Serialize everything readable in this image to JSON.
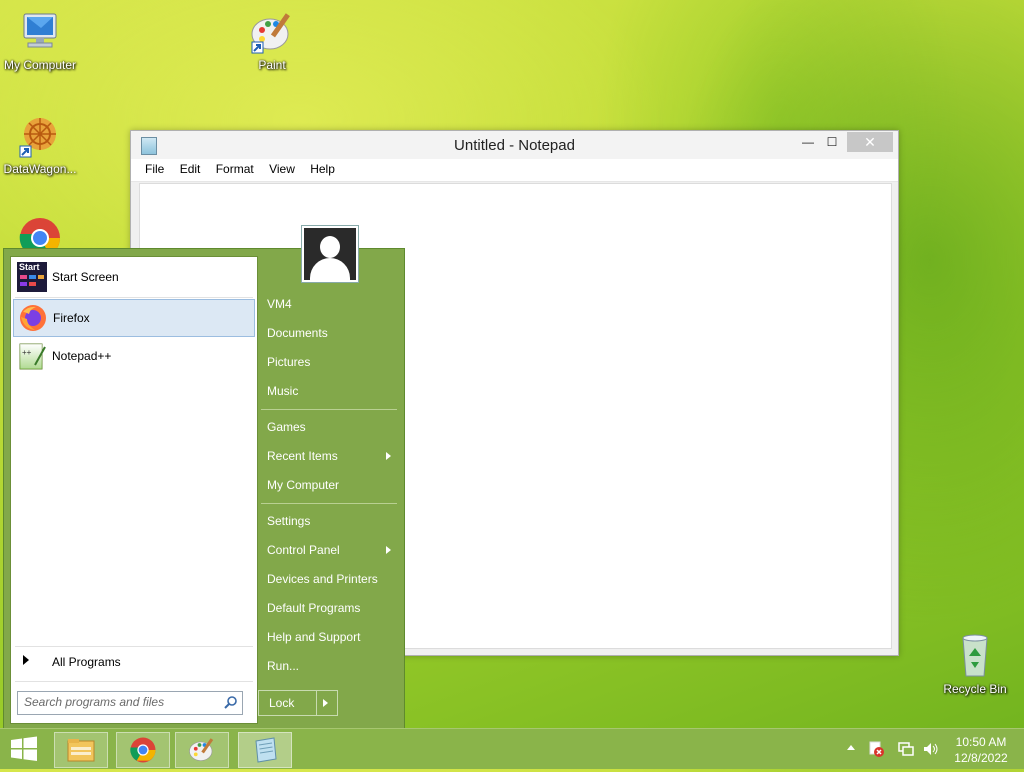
{
  "desktop": {
    "icons": [
      {
        "label": "My Computer",
        "icon": "computer-icon"
      },
      {
        "label": "Paint",
        "icon": "paint-icon"
      },
      {
        "label": "DataWagon...",
        "icon": "datawagon-icon"
      },
      {
        "label": "Recycle Bin",
        "icon": "recycle-bin-icon"
      }
    ]
  },
  "notepad": {
    "title": "Untitled - Notepad",
    "menu": [
      "File",
      "Edit",
      "Format",
      "View",
      "Help"
    ],
    "buttons": {
      "minimize": "—",
      "maximize": "☐",
      "close": "✕"
    },
    "content": ""
  },
  "start_menu": {
    "pinned": [
      {
        "label": "Start Screen",
        "icon": "start-screen-icon"
      },
      {
        "label": "Firefox",
        "icon": "firefox-icon",
        "selected": true
      },
      {
        "label": "Notepad++",
        "icon": "notepadpp-icon"
      }
    ],
    "all_programs": "All Programs",
    "search_placeholder": "Search programs and files",
    "right_items": [
      {
        "label": "VM4"
      },
      {
        "label": "Documents"
      },
      {
        "label": "Pictures"
      },
      {
        "label": "Music"
      },
      {
        "label": "Games"
      },
      {
        "label": "Recent Items",
        "submenu": true
      },
      {
        "label": "My Computer"
      },
      {
        "label": "Settings"
      },
      {
        "label": "Control Panel",
        "submenu": true
      },
      {
        "label": "Devices and Printers"
      },
      {
        "label": "Default Programs"
      },
      {
        "label": "Help and Support"
      },
      {
        "label": "Run..."
      }
    ],
    "lock_label": "Lock",
    "start_tile_text": "Start"
  },
  "taskbar": {
    "pinned": [
      "file-explorer-icon",
      "chrome-icon",
      "paint-icon",
      "notepad-icon"
    ],
    "tray": [
      "up-arrow-icon",
      "action-center-icon",
      "network-icon",
      "volume-icon"
    ],
    "time": "10:50 AM",
    "date": "12/8/2022"
  },
  "colors": {
    "start_menu_bg": "#82a84a",
    "taskbar_bg": "#8ab44a",
    "selection": "#dce8f4"
  }
}
